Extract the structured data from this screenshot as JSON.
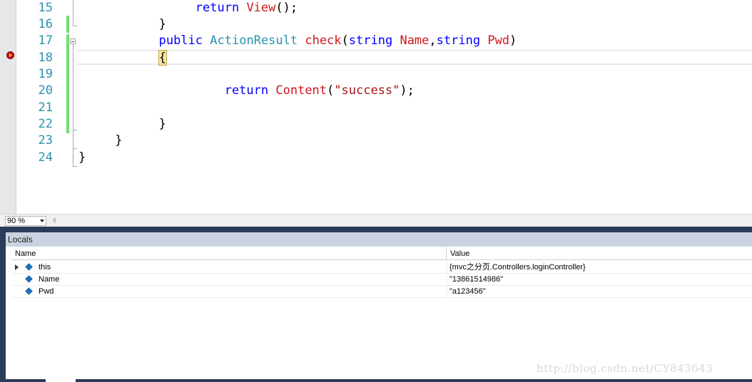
{
  "editor": {
    "line_numbers": [
      "15",
      "16",
      "17",
      "18",
      "19",
      "20",
      "21",
      "22",
      "23",
      "24"
    ],
    "lines": {
      "l15": {
        "kw": "return",
        "fn": "View",
        "rest": "();"
      },
      "l16": "}",
      "l17": {
        "kw1": "public",
        "ty": "ActionResult",
        "fn": "check",
        "p1": "(",
        "kw2": "string",
        "arg1": "Name",
        "comma": ",",
        "kw3": "string",
        "arg2": "Pwd",
        "p2": ")"
      },
      "l18": "{",
      "l20": {
        "kw": "return",
        "fn": "Content",
        "p1": "(",
        "str": "\"success\"",
        "p2": ");"
      },
      "l22": "}",
      "l23": "}",
      "l24": "}"
    },
    "breakpoint_icon": "breakpoint-current-icon"
  },
  "zoom": {
    "value": "90 %"
  },
  "locals": {
    "title": "Locals",
    "columns": {
      "name": "Name",
      "value": "Value"
    },
    "rows": [
      {
        "name": "this",
        "value": "{mvc之分页.Controllers.loginController}",
        "expandable": true,
        "icon": "object-icon"
      },
      {
        "name": "Name",
        "value": "\"13861514986\"",
        "expandable": false,
        "icon": "field-icon"
      },
      {
        "name": "Pwd",
        "value": "\"a123456\"",
        "expandable": false,
        "icon": "field-icon"
      }
    ]
  },
  "watermark": "http://blog.csdn.net/CY843643",
  "colors": {
    "keyword": "#0000ff",
    "type": "#2b91af",
    "method": "#d2161b",
    "string": "#a31515",
    "line_number": "#2b91af",
    "change_bar": "#6ee06e",
    "tool_window_frame": "#2b3c59"
  }
}
